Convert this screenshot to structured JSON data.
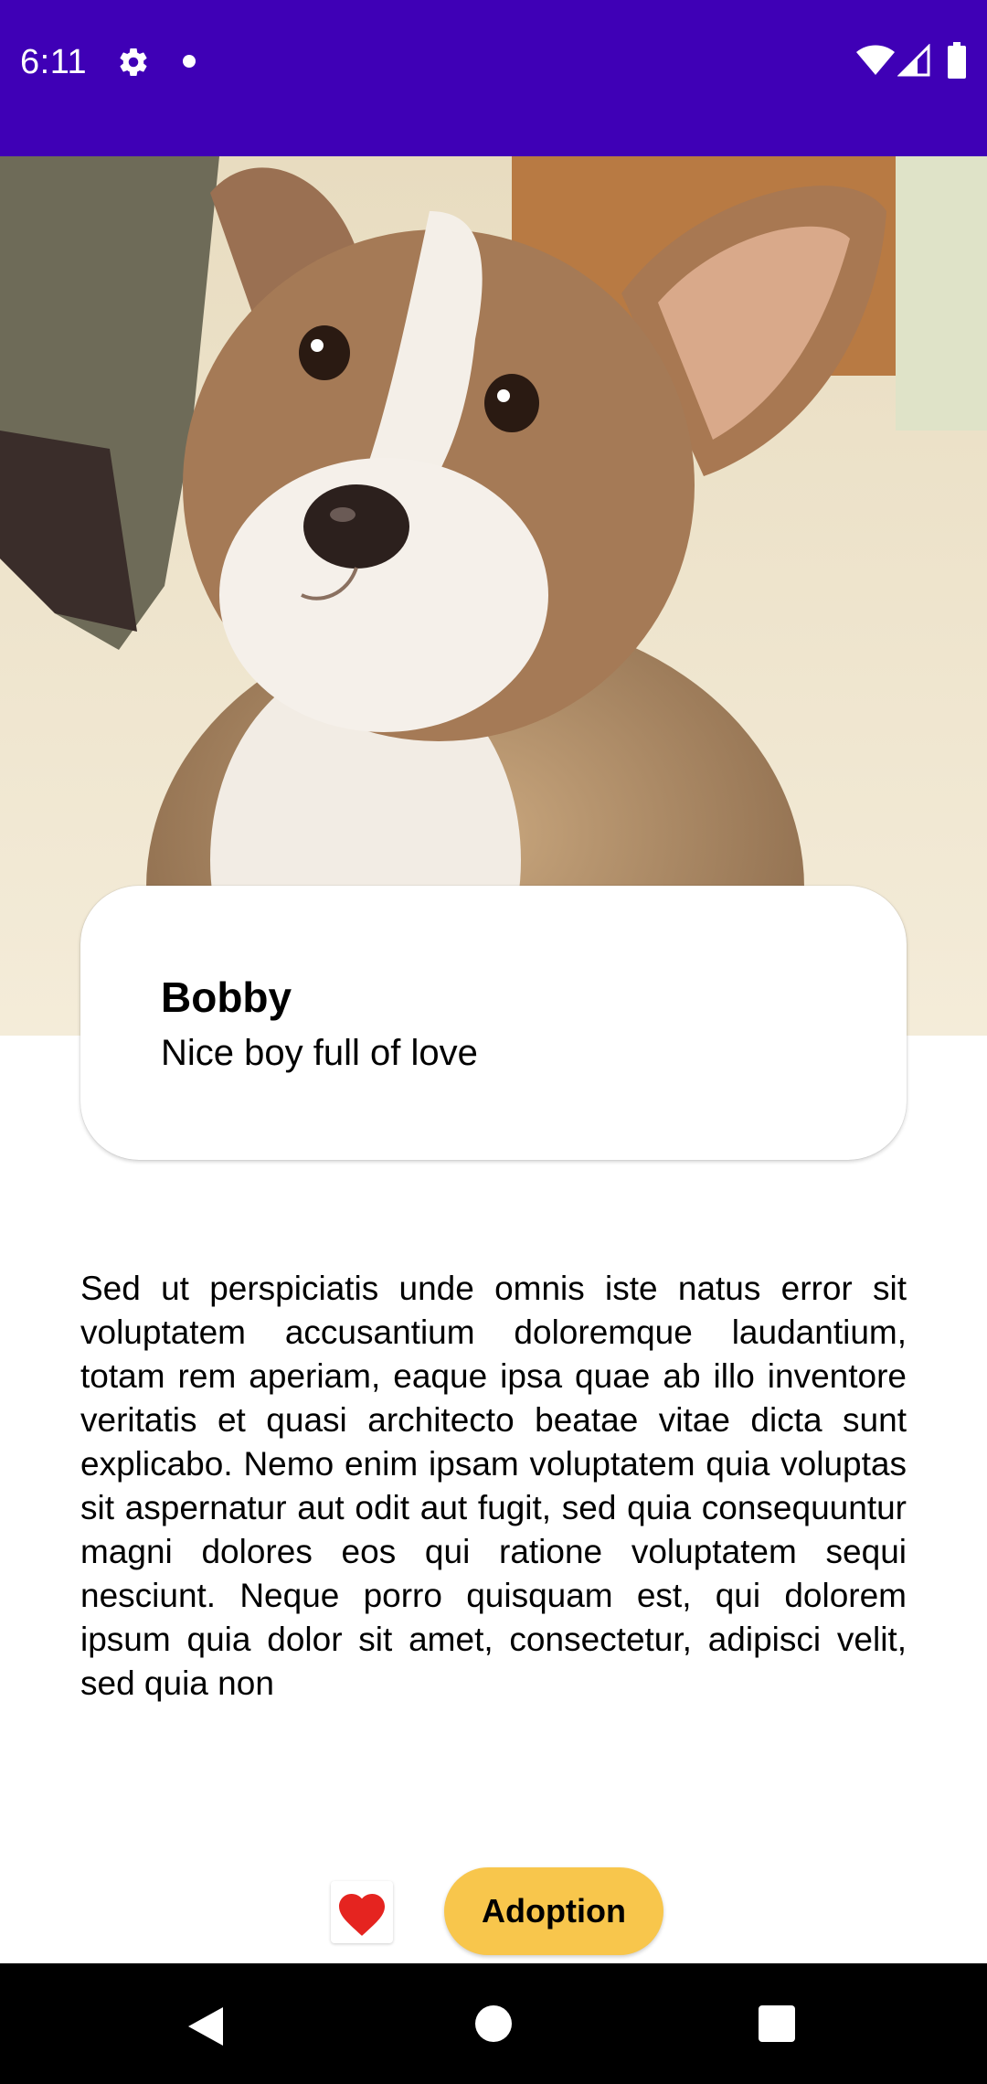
{
  "status_bar": {
    "time": "6:11",
    "background_color": "#3f00b6",
    "icons": [
      "gear-icon",
      "notification-dot-icon",
      "wifi-icon",
      "cell-signal-icon",
      "battery-icon"
    ]
  },
  "hero": {
    "image": "dog-photo"
  },
  "pet": {
    "name": "Bobby",
    "tagline": "Nice boy full of love"
  },
  "description": "Sed ut perspiciatis unde omnis iste natus error sit voluptatem accusantium doloremque laudantium, totam rem aperiam, eaque ipsa quae ab illo inventore veritatis et quasi architecto beatae vitae dicta sunt explicabo. Nemo enim ipsam voluptatem quia voluptas sit aspernatur aut odit aut fugit, sed quia consequuntur magni dolores eos qui ratione voluptatem sequi nesciunt. Neque porro quisquam est, qui dolorem ipsum quia dolor sit amet, consectetur, adipisci velit, sed quia non",
  "actions": {
    "like_icon": "heart-icon",
    "like_color": "#e52420",
    "adopt_label": "Adoption",
    "adopt_color": "#f8c64c"
  },
  "nav_bar": {
    "icons": [
      "back-icon",
      "home-icon",
      "recents-icon"
    ]
  }
}
